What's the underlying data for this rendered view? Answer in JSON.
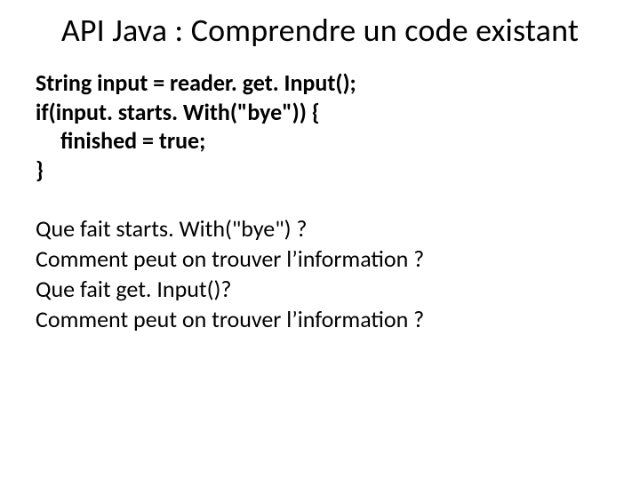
{
  "title": "API Java : Comprendre un code existant",
  "code": {
    "l1": "String input = reader. get. Input();",
    "l2": "if(input. starts. With(\"bye\")) {",
    "l3": "finished = true;",
    "l4": "}"
  },
  "questions": {
    "q1": "Que fait starts. With(\"bye\") ?",
    "q2": "Comment peut on trouver l’information ?",
    "q3": "Que fait get. Input()?",
    "q4": "Comment peut on trouver l’information ?"
  }
}
